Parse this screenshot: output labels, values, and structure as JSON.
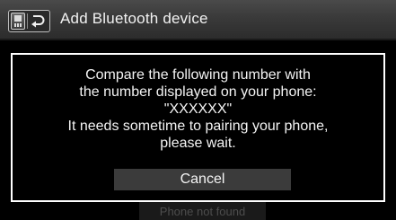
{
  "header": {
    "title": "Add Bluetooth device",
    "phone_icon": "phone-icon",
    "back_icon": "back-arrow-icon"
  },
  "dialog": {
    "lines": [
      "Compare the following number with",
      "the number displayed on your phone:",
      "\"XXXXXX\"",
      "It needs sometime to pairing your phone,",
      "please wait."
    ],
    "cancel_label": "Cancel"
  },
  "background": {
    "button_label": "Phone not found"
  },
  "colors": {
    "background": "#000000",
    "text": "#f4f4f4",
    "button": "#3b3b3b",
    "dialog_border": "#ffffff"
  }
}
